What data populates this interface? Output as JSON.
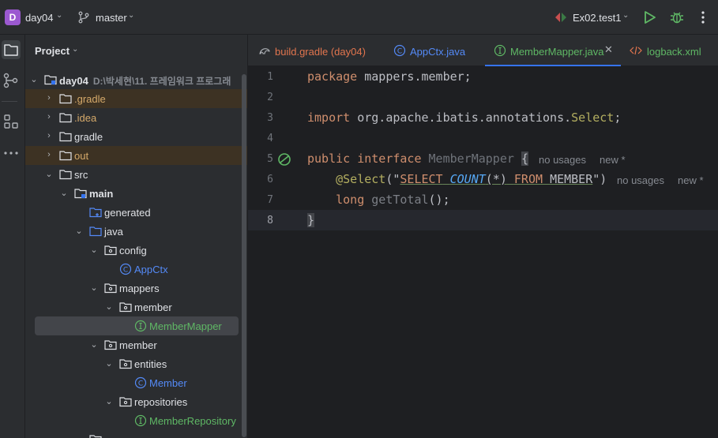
{
  "titlebar": {
    "project_badge": "D",
    "project_name": "day04",
    "branch": "master",
    "run_config": "Ex02.test1"
  },
  "panel": {
    "title": "Project",
    "tree": [
      {
        "label": "day04",
        "path": "D:\\박세현\\11. 프레임워크 프로그래"
      },
      {
        "label": ".gradle"
      },
      {
        "label": ".idea"
      },
      {
        "label": "gradle"
      },
      {
        "label": "out"
      },
      {
        "label": "src"
      },
      {
        "label": "main"
      },
      {
        "label": "generated"
      },
      {
        "label": "java"
      },
      {
        "label": "config"
      },
      {
        "label": "AppCtx"
      },
      {
        "label": "mappers"
      },
      {
        "label": "member"
      },
      {
        "label": "MemberMapper"
      },
      {
        "label": "member"
      },
      {
        "label": "entities"
      },
      {
        "label": "Member"
      },
      {
        "label": "repositories"
      },
      {
        "label": "MemberRepository"
      }
    ]
  },
  "tabs": [
    {
      "label": "build.gradle (day04)",
      "color": "#e2754e"
    },
    {
      "label": "AppCtx.java",
      "color": "#548af7"
    },
    {
      "label": "MemberMapper.java",
      "color": "#5fb865"
    },
    {
      "label": "logback.xml",
      "color": "#5fb865"
    }
  ],
  "editor": {
    "line_numbers": [
      "1",
      "2",
      "3",
      "4",
      "5",
      "6",
      "7",
      "8"
    ],
    "line1": {
      "kw": "package",
      "rest": " mappers.member;"
    },
    "line3": {
      "kw": "import",
      "rest": " org.apache.ibatis.annotations.",
      "ann": "Select",
      "end": ";"
    },
    "line5": {
      "kw": "public interface",
      "name": "MemberMapper",
      "brace": "{",
      "hint1": "no usages",
      "hint2": "new *"
    },
    "line6": {
      "ann": "@Select",
      "p1": "(\"",
      "s1": "SELECT",
      "s2": "COUNT",
      "s3": "(*)",
      "s4": "FROM",
      "s5": "MEMBER",
      "p2": "\")",
      "hint1": "no usages",
      "hint2": "new *"
    },
    "line7": {
      "kw": "long",
      "method": "getTotal",
      "rest": "();"
    },
    "line8": "}"
  },
  "colors": {
    "accent": "#3574f0",
    "excluded_bg": "#3d3223",
    "keyword": "#cf8e6d",
    "string": "#6aab73"
  }
}
